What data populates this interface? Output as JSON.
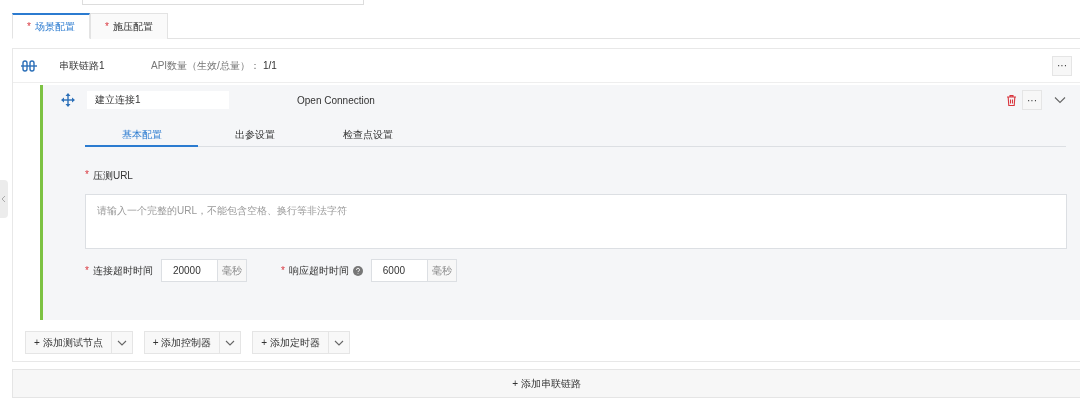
{
  "top_field": {
    "kind": "input"
  },
  "tabs": [
    {
      "mark": "*",
      "label": "场景配置",
      "selected": true
    },
    {
      "mark": "*",
      "label": "施压配置",
      "selected": false
    }
  ],
  "chain": {
    "name": "串联链路1",
    "api_label": "API数量（生效/总量）：",
    "api_count": "1/1",
    "more": "···",
    "step": {
      "name": "建立连接1",
      "type": "Open Connection",
      "more": "···",
      "expanded": true,
      "subtabs": [
        {
          "label": "基本配置",
          "selected": true
        },
        {
          "label": "出参设置",
          "selected": false
        },
        {
          "label": "检查点设置",
          "selected": false
        }
      ],
      "url": {
        "mark": "*",
        "label": "压测URL",
        "placeholder": "请输入一个完整的URL，不能包含空格、换行等非法字符"
      },
      "timeouts": [
        {
          "mark": "*",
          "label": "连接超时时间",
          "help": false,
          "value": "20000",
          "unit": "毫秒"
        },
        {
          "mark": "*",
          "label": "响应超时时间",
          "help": true,
          "value": "6000",
          "unit": "毫秒"
        }
      ]
    },
    "add_buttons": [
      {
        "plus": "+",
        "label": "添加测试节点"
      },
      {
        "plus": "+",
        "label": "添加控制器"
      },
      {
        "plus": "+",
        "label": "添加定时器"
      }
    ]
  },
  "add_chain": {
    "label": "+ 添加串联链路"
  }
}
